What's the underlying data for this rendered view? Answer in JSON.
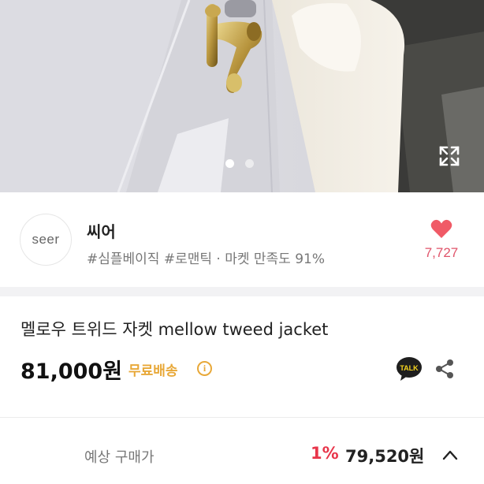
{
  "gallery": {
    "slides_total": 2,
    "active_slide": 1
  },
  "shop": {
    "avatar_text": "seer",
    "name": "씨어",
    "tags": "#심플베이직 #로맨틱 · 마켓 만족도 91%",
    "like_count": "7,727"
  },
  "product": {
    "title": "멜로우 트위드 자켓 mellow tweed jacket",
    "price": "81,000원",
    "shipping": "무료배송",
    "info_symbol": "i",
    "talk_label": "TALK"
  },
  "expected_price": {
    "label": "예상 구매가",
    "discount": "1%",
    "price": "79,520원"
  },
  "colors": {
    "heart": "#f05a66",
    "like_text": "#e0546a",
    "shipping": "#e8a838",
    "discount": "#e8354a",
    "talk_bubble": "#1e1e1e"
  },
  "icons": {
    "expand": "expand-icon",
    "heart": "heart-icon",
    "info": "info-icon",
    "talk": "kakao-talk-icon",
    "share": "share-icon",
    "chevron": "chevron-up-icon"
  }
}
